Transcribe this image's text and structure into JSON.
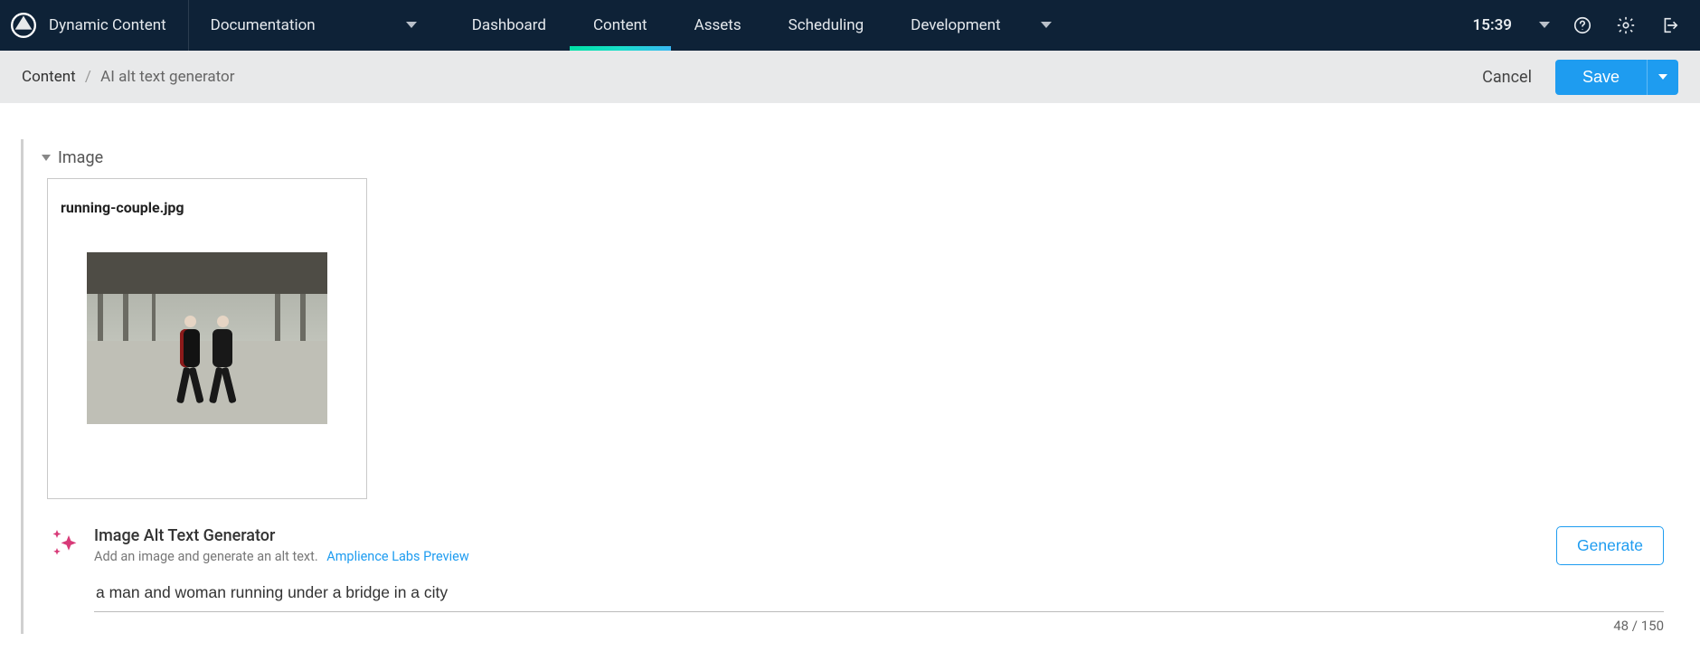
{
  "nav": {
    "brand": "Dynamic Content",
    "hub": "Documentation",
    "tabs": [
      "Dashboard",
      "Content",
      "Assets",
      "Scheduling",
      "Development"
    ],
    "active_tab": "Content",
    "time": "15:39"
  },
  "subbar": {
    "root": "Content",
    "current": "AI alt text generator",
    "cancel": "Cancel",
    "save": "Save"
  },
  "editor": {
    "image_section_label": "Image",
    "image_filename": "running-couple.jpg"
  },
  "altgen": {
    "title": "Image Alt Text Generator",
    "subtitle": "Add an image and generate an alt text.",
    "preview_link": "Amplience Labs Preview",
    "generate_label": "Generate",
    "value": "a man and woman running under a bridge in a city",
    "count": "48 / 150"
  }
}
